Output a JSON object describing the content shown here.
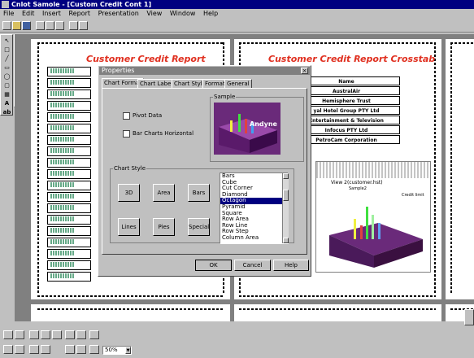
{
  "app": {
    "title": "Cnlot Samole - [Custom Credit Cont 1]"
  },
  "menu": [
    "File",
    "Edit",
    "Insert",
    "Report",
    "Presentation",
    "View",
    "Window",
    "Help"
  ],
  "workspace": {
    "left_report_title": "Customer Credit Report",
    "right_report_title": "Customer Credit Report Crosstab",
    "crosstab": {
      "header": "Name",
      "rows": [
        "AustralAir",
        "Hemisphere Trust",
        "yal Hotel Group PTY Ltd",
        "Entertainment & Television",
        "Infocus PTY Ltd",
        "PetroCam Corporation"
      ]
    },
    "chart_caption": "View 2(customer.hst)",
    "chart_subcaption": "Sample2",
    "chart_legend": "Credit limit"
  },
  "dialog": {
    "title": "Properties",
    "tabs": [
      "Chart Format",
      "Chart Labels",
      "Chart Styles",
      "Format",
      "General"
    ],
    "pivot_label": "Pivot Data",
    "bar_horizontal_label": "Bar Charts Horizontal",
    "sample_label": "Sample",
    "sample_brand": "Andyne",
    "chart_style_label": "Chart Style",
    "style_buttons": [
      "3D",
      "Area",
      "Bars",
      "Lines",
      "Pies",
      "Special"
    ],
    "list_items": [
      "Bars",
      "Cube",
      "Cut Corner",
      "Diamond",
      "Octagon",
      "Pyramid",
      "Square",
      "Row Area",
      "Row Line",
      "Row Step",
      "Column Area"
    ],
    "list_selected": "Octagon",
    "ok": "OK",
    "cancel": "Cancel",
    "help": "Help"
  },
  "statusbar": {
    "zoom": "50%"
  },
  "colors": {
    "title_bar": "#000080",
    "report_title": "#e03020",
    "chart_bg": "#6a2a7a"
  }
}
